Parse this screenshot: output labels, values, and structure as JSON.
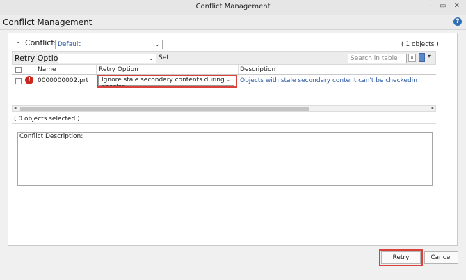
{
  "window": {
    "title": "Conflict Management",
    "controls": "– ▭ ✕"
  },
  "header": {
    "title": "Conflict Management",
    "help": "?"
  },
  "conflicts": {
    "label": "Conflicts",
    "filter_value": "Default",
    "count": "( 1 objects )"
  },
  "toolbar": {
    "retry_option_label": "Retry Option",
    "retry_option_value": "",
    "set_label": "Set",
    "search_placeholder": "Search in table"
  },
  "table": {
    "columns": [
      "Name",
      "Retry Option",
      "Description"
    ],
    "rows": [
      {
        "name": "0000000002.prt",
        "retry_option": "Ignore stale secondary contents during checkin",
        "description": "Objects with stale secondary content can't be checkedin"
      }
    ]
  },
  "selection_status": "( 0 objects selected )",
  "conflict_description": {
    "label": "Conflict Description:"
  },
  "footer": {
    "retry_label": "Retry",
    "cancel_label": "Cancel"
  }
}
